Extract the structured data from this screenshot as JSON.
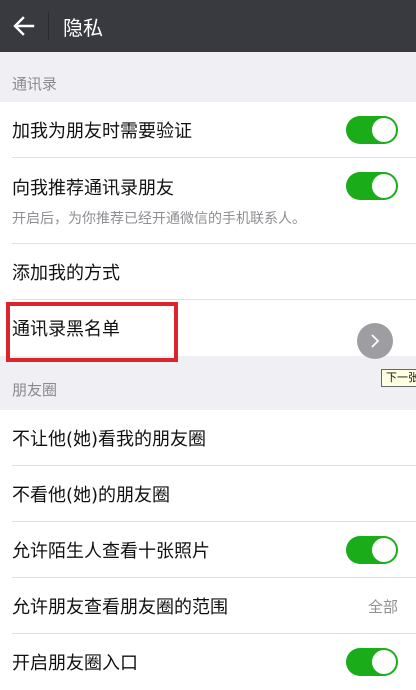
{
  "header": {
    "title": "隐私",
    "back_icon": "arrow-left-icon"
  },
  "sections": {
    "contacts": {
      "title": "通讯录",
      "items": [
        {
          "label": "加我为朋友时需要验证",
          "toggle": true
        },
        {
          "label": "向我推荐通讯录朋友",
          "desc": "开启后，为你推荐已经开通微信的手机联系人。",
          "toggle": true
        },
        {
          "label": "添加我的方式"
        },
        {
          "label": "通讯录黑名单"
        }
      ]
    },
    "moments": {
      "title": "朋友圈",
      "items": [
        {
          "label": "不让他(她)看我的朋友圈"
        },
        {
          "label": "不看他(她)的朋友圈"
        },
        {
          "label": "允许陌生人查看十张照片",
          "toggle": true
        },
        {
          "label": "允许朋友查看朋友圈的范围",
          "value": "全部"
        },
        {
          "label": "开启朋友圈入口",
          "toggle": true
        }
      ]
    }
  },
  "overlay": {
    "next_icon": "chevron-right-icon",
    "tooltip": "下一张"
  },
  "colors": {
    "topbar": "#393a3f",
    "toggle_on": "#1aad19",
    "highlight": "#d9262c"
  }
}
